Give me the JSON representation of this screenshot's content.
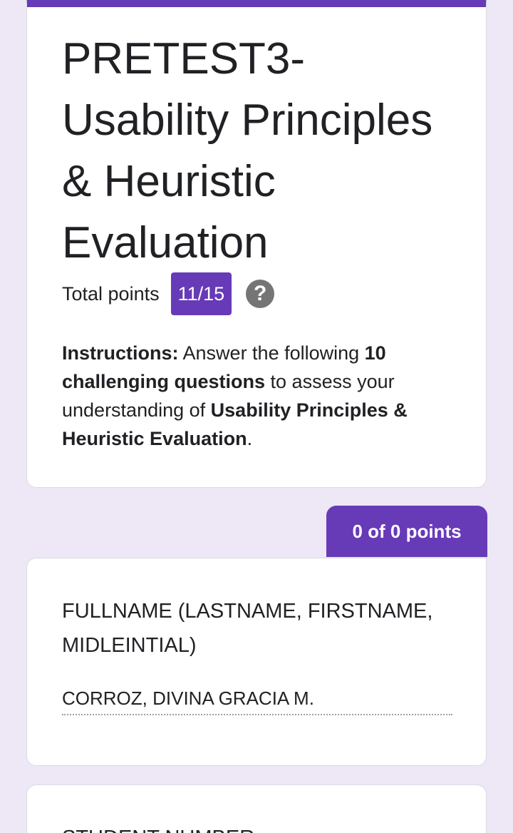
{
  "form": {
    "title": "PRETEST3- Usability Principles & Heuristic Evaluation",
    "total_points_label": "Total points",
    "score": "11/15",
    "help_icon_glyph": "?",
    "instructions": {
      "lead": "Instructions:",
      "text1": " Answer the following ",
      "bold1": "10 challenging questions",
      "text2": " to assess your understanding of ",
      "bold2": "Usability Principles & Heuristic Evaluation",
      "text3": "."
    }
  },
  "section": {
    "points_label": "0 of 0 points"
  },
  "questions": [
    {
      "title": "FULLNAME (LASTNAME, FIRSTNAME, MIDLEINTIAL)",
      "answer": "CORROZ, DIVINA GRACIA M."
    },
    {
      "title": "STUDENT NUMBER"
    }
  ],
  "colors": {
    "accent": "#673ab7",
    "background": "#ede7f6",
    "card": "#ffffff"
  }
}
